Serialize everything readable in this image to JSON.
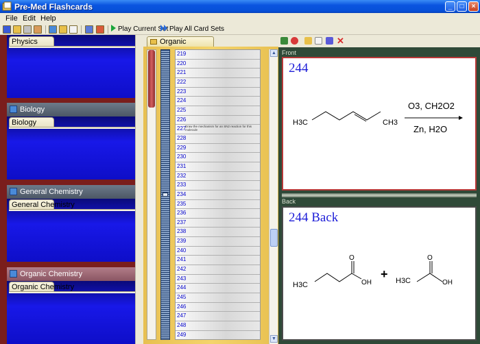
{
  "window": {
    "title": "Pre-Med Flashcards"
  },
  "menu": [
    "File",
    "Edit",
    "Help"
  ],
  "toolbar": {
    "play_current": "Play Current Set",
    "play_all": "Play All Card Sets"
  },
  "card_sets": [
    {
      "name": "",
      "tab": "Physics",
      "active": false
    },
    {
      "name": "Biology",
      "tab": "Biology",
      "active": false
    },
    {
      "name": "General Chemistry",
      "tab": "General Chemistry",
      "active": false
    },
    {
      "name": "Organic Chemistry",
      "tab": "Organic Chemistry",
      "active": true
    }
  ],
  "current_set": {
    "tab": "Organic Chemistry"
  },
  "cards": [
    {
      "n": "219",
      "text": ""
    },
    {
      "n": "220",
      "text": ""
    },
    {
      "n": "221",
      "text": ""
    },
    {
      "n": "222",
      "text": ""
    },
    {
      "n": "223",
      "text": ""
    },
    {
      "n": "224",
      "text": ""
    },
    {
      "n": "225",
      "text": ""
    },
    {
      "n": "226",
      "text": ""
    },
    {
      "n": "227",
      "text": "Draw the mechanism for an SN2 reaction for this molecule"
    },
    {
      "n": "228",
      "text": ""
    },
    {
      "n": "229",
      "text": ""
    },
    {
      "n": "230",
      "text": ""
    },
    {
      "n": "231",
      "text": ""
    },
    {
      "n": "232",
      "text": ""
    },
    {
      "n": "233",
      "text": ""
    },
    {
      "n": "234",
      "text": ""
    },
    {
      "n": "235",
      "text": ""
    },
    {
      "n": "236",
      "text": ""
    },
    {
      "n": "237",
      "text": ""
    },
    {
      "n": "238",
      "text": ""
    },
    {
      "n": "239",
      "text": ""
    },
    {
      "n": "240",
      "text": ""
    },
    {
      "n": "241",
      "text": ""
    },
    {
      "n": "242",
      "text": ""
    },
    {
      "n": "243",
      "text": ""
    },
    {
      "n": "244",
      "text": ""
    },
    {
      "n": "245",
      "text": ""
    },
    {
      "n": "246",
      "text": ""
    },
    {
      "n": "247",
      "text": ""
    },
    {
      "n": "248",
      "text": ""
    },
    {
      "n": "249",
      "text": ""
    }
  ],
  "front": {
    "label": "Front",
    "title": "244",
    "reagent_top": "O3, CH2O2",
    "reagent_bottom": "Zn, H2O",
    "left_group": "H3C",
    "right_group": "CH3"
  },
  "back": {
    "label": "Back",
    "title": "244 Back",
    "plus": "+",
    "mol1_group": "H3C",
    "mol1_oh": "OH",
    "mol1_o": "O",
    "mol2_group": "H3C",
    "mol2_oh": "OH",
    "mol2_o": "O"
  },
  "colors": {
    "title_bar": "#0a54e0",
    "left_panel": "#7a1e1c",
    "card_body": "#1818e8",
    "right_panel": "#2f4a38",
    "card_title": "#1e1ed8"
  }
}
